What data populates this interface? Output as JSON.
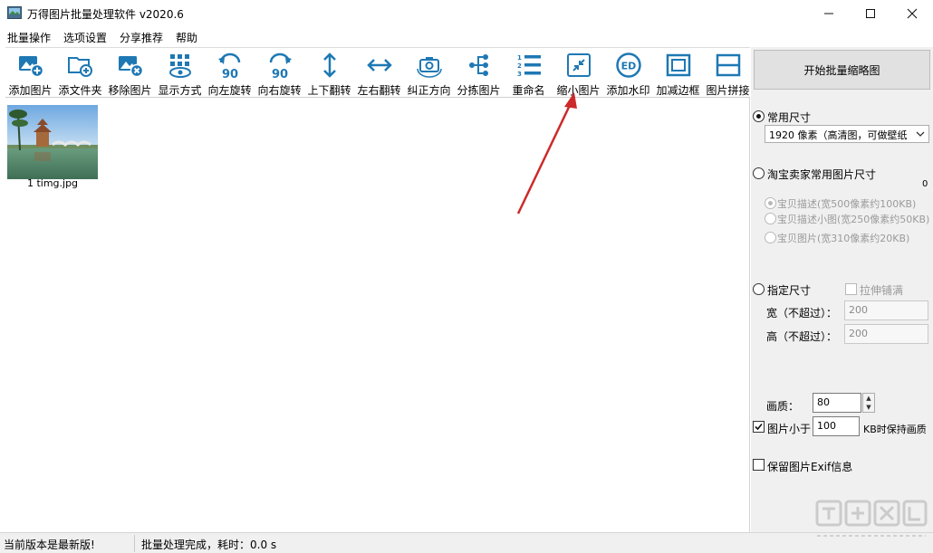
{
  "window": {
    "title": "万得图片批量处理软件 v2020.6",
    "minimize": "─",
    "maximize": "☐",
    "close": "✕"
  },
  "menu": [
    "批量操作",
    "选项设置",
    "分享推荐",
    "帮助"
  ],
  "toolbar": [
    {
      "label": "添加图片",
      "icon": "add-image-icon"
    },
    {
      "label": "添文件夹",
      "icon": "add-folder-icon"
    },
    {
      "label": "移除图片",
      "icon": "remove-image-icon"
    },
    {
      "label": "显示方式",
      "icon": "display-mode-icon"
    },
    {
      "label": "向左旋转",
      "icon": "rotate-left-icon"
    },
    {
      "label": "向右旋转",
      "icon": "rotate-right-icon"
    },
    {
      "label": "上下翻转",
      "icon": "flip-vertical-icon"
    },
    {
      "label": "左右翻转",
      "icon": "flip-horizontal-icon"
    },
    {
      "label": "纠正方向",
      "icon": "correct-orientation-icon"
    },
    {
      "label": "分拣图片",
      "icon": "sort-images-icon"
    },
    {
      "label": "重命名",
      "icon": "rename-icon"
    },
    {
      "label": "缩小图片",
      "icon": "shrink-image-icon"
    },
    {
      "label": "添加水印",
      "icon": "watermark-icon"
    },
    {
      "label": "加减边框",
      "icon": "border-icon"
    },
    {
      "label": "图片拼接",
      "icon": "stitch-icon"
    }
  ],
  "rotate_badge": "90",
  "watermark_badge": "ED",
  "images": [
    {
      "name": "1 timg.jpg"
    }
  ],
  "panel": {
    "start_button": "开始批量缩略图",
    "common_size": {
      "label": "常用尺寸",
      "selected": "1920 像素（高清图，可做壁纸"
    },
    "taobao": {
      "label": "淘宝卖家常用图片尺寸",
      "side_value": "0",
      "options": [
        "宝贝描述(宽500像素约100KB)",
        "宝贝描述小图(宽250像素约50KB)",
        "宝贝图片(宽310像素约20KB)"
      ]
    },
    "custom": {
      "label": "指定尺寸",
      "stretch": "拉伸铺满",
      "width_label": "宽（不超过）：",
      "width_value": "200",
      "height_label": "高（不超过）：",
      "height_value": "200"
    },
    "quality": {
      "label": "画质：",
      "value": "80"
    },
    "keep_quality": {
      "prefix": "图片小于",
      "value": "100",
      "suffix": "KB时保持画质"
    },
    "exif": "保留图片Exif信息"
  },
  "status": {
    "version": "当前版本是最新版!",
    "result": "批量处理完成，耗时：0.0 s"
  },
  "colors": {
    "icon_blue": "#1e78b4",
    "arrow_red": "#cc2a2a"
  }
}
